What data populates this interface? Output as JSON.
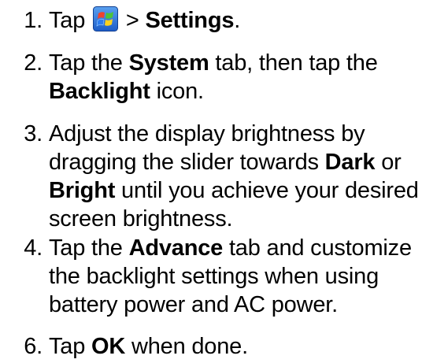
{
  "steps": [
    {
      "number": "1.",
      "lines": [
        [
          {
            "text": "Tap ",
            "bold": false
          },
          {
            "icon": "windows-start-icon"
          },
          {
            "text": " > ",
            "bold": false
          },
          {
            "text": "Settings",
            "bold": true
          },
          {
            "text": ".",
            "bold": false
          }
        ]
      ]
    },
    {
      "number": "2.",
      "lines": [
        [
          {
            "text": "Tap the ",
            "bold": false
          },
          {
            "text": "System",
            "bold": true
          },
          {
            "text": " tab, then tap the",
            "bold": false
          }
        ],
        [
          {
            "text": "Backlight",
            "bold": true
          },
          {
            "text": " icon.",
            "bold": false
          }
        ]
      ]
    },
    {
      "number": "3.",
      "lines": [
        [
          {
            "text": "Adjust the display brightness by",
            "bold": false
          }
        ],
        [
          {
            "text": "dragging the slider towards ",
            "bold": false
          },
          {
            "text": "Dark",
            "bold": true
          },
          {
            "text": " or",
            "bold": false
          }
        ],
        [
          {
            "text": "Bright",
            "bold": true
          },
          {
            "text": " until you achieve your desired",
            "bold": false
          }
        ],
        [
          {
            "text": "screen brightness.",
            "bold": false
          }
        ]
      ]
    },
    {
      "number": "4.",
      "lines": [
        [
          {
            "text": "Tap the ",
            "bold": false
          },
          {
            "text": "Advance",
            "bold": true
          },
          {
            "text": " tab and customize",
            "bold": false
          }
        ],
        [
          {
            "text": "the backlight settings when using",
            "bold": false
          }
        ],
        [
          {
            "text": "battery power and AC power.",
            "bold": false
          }
        ]
      ]
    },
    {
      "number": "6.",
      "lines": [
        [
          {
            "text": "Tap ",
            "bold": false
          },
          {
            "text": "OK",
            "bold": true
          },
          {
            "text": " when done.",
            "bold": false
          }
        ]
      ]
    }
  ]
}
